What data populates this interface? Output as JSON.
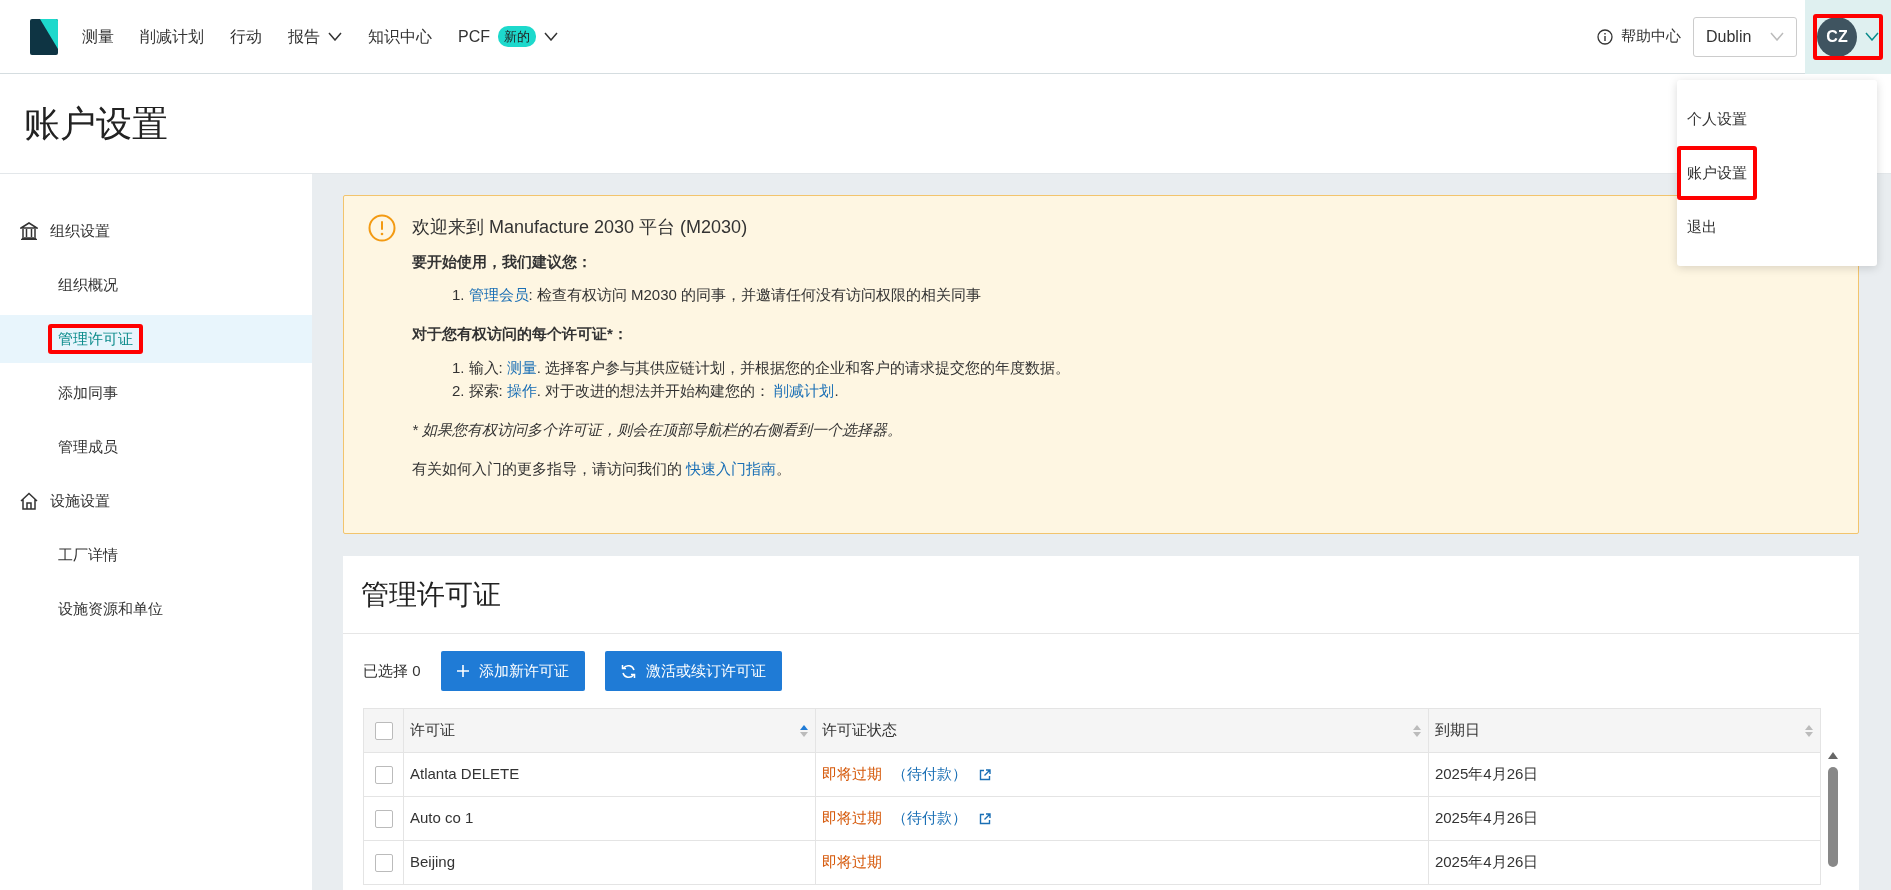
{
  "navbar": {
    "items": [
      {
        "label": "测量",
        "dropdown": false
      },
      {
        "label": "削减计划",
        "dropdown": false
      },
      {
        "label": "行动",
        "dropdown": false
      },
      {
        "label": "报告",
        "dropdown": true
      },
      {
        "label": "知识中心",
        "dropdown": false
      },
      {
        "label": "PCF",
        "badge": "新的",
        "dropdown": true
      }
    ],
    "help": "帮助中心",
    "site_selector": "Dublin",
    "avatar": {
      "initials": "CZ",
      "highlighted": true,
      "expanded": true
    }
  },
  "user_menu": [
    {
      "label": "个人设置",
      "highlighted": false
    },
    {
      "label": "账户设置",
      "highlighted": true
    },
    {
      "label": "退出",
      "highlighted": false
    }
  ],
  "page_title": "账户设置",
  "sidebar": {
    "groups": [
      {
        "label": "组织设置",
        "items": [
          {
            "label": "组织概况",
            "selected": false,
            "highlighted": false
          },
          {
            "label": "管理许可证",
            "selected": true,
            "highlighted": true
          },
          {
            "label": "添加同事",
            "selected": false,
            "highlighted": false
          },
          {
            "label": "管理成员",
            "selected": false,
            "highlighted": false
          }
        ]
      },
      {
        "label": "设施设置",
        "items": [
          {
            "label": "工厂详情",
            "selected": false,
            "highlighted": false
          },
          {
            "label": "设施资源和单位",
            "selected": false,
            "highlighted": false
          }
        ]
      }
    ]
  },
  "banner": {
    "title": "欢迎来到 Manufacture 2030 平台 (M2030)",
    "blocks": [
      {
        "kind": "heading",
        "text": "要开始使用，我们建议您："
      },
      {
        "kind": "list",
        "items": [
          {
            "marker": "1.",
            "segments": [
              {
                "text": "管理会员",
                "link": true
              },
              {
                "text": ": 检查有权访问 M2030 的同事，并邀请任何没有访问权限的相关同事",
                "link": false
              }
            ]
          }
        ]
      },
      {
        "kind": "heading",
        "text": "对于您有权访问的每个许可证*："
      },
      {
        "kind": "list",
        "items": [
          {
            "marker": "1.",
            "segments": [
              {
                "text": "输入: ",
                "link": false
              },
              {
                "text": "测量",
                "link": true
              },
              {
                "text": ". 选择客户参与其供应链计划，并根据您的企业和客户的请求提交您的年度数据。",
                "link": false
              }
            ]
          },
          {
            "marker": "2.",
            "segments": [
              {
                "text": "探索: ",
                "link": false
              },
              {
                "text": "操作",
                "link": true
              },
              {
                "text": ". 对于改进的想法并开始构建您的： ",
                "link": false
              },
              {
                "text": "削减计划",
                "link": true
              },
              {
                "text": ".",
                "link": false
              }
            ]
          }
        ]
      },
      {
        "kind": "note",
        "text": "* 如果您有权访问多个许可证，则会在顶部导航栏的右侧看到一个选择器。"
      },
      {
        "kind": "para",
        "segments": [
          {
            "text": "有关如何入门的更多指导，请访问我们的 ",
            "link": false
          },
          {
            "text": "快速入门指南",
            "link": true
          },
          {
            "text": "。",
            "link": false
          }
        ]
      }
    ]
  },
  "licenses": {
    "title": "管理许可证",
    "selected_count": "已选择 0",
    "buttons": [
      {
        "label": "添加新许可证"
      },
      {
        "label": "激活或续订许可证"
      }
    ],
    "select_all": {
      "checked": false
    },
    "columns": [
      {
        "label": "许可证",
        "sorted": true
      },
      {
        "label": "许可证状态",
        "sorted": false
      },
      {
        "label": "到期日",
        "sorted": false
      }
    ],
    "rows": [
      {
        "checked": false,
        "license": "Atlanta DELETE",
        "status": "即将过期",
        "status_detail": "（待付款）",
        "external_link": true,
        "expiry": "2025年4月26日"
      },
      {
        "checked": false,
        "license": "Auto co 1",
        "status": "即将过期",
        "status_detail": "（待付款）",
        "external_link": true,
        "expiry": "2025年4月26日"
      },
      {
        "checked": false,
        "license": "Beijing",
        "status": "即将过期",
        "external_link": false,
        "expiry": "2025年4月26日"
      }
    ]
  }
}
